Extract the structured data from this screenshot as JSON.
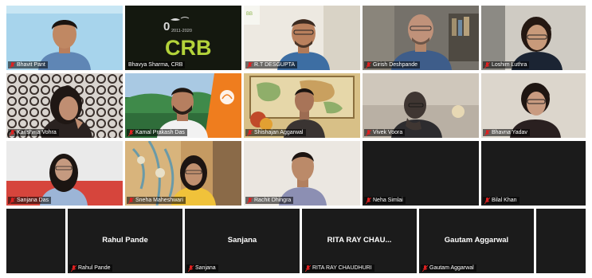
{
  "meeting": {
    "background": "#1b1b1b",
    "mic_muted_color": "#e02020",
    "active_speaker_color": "#f5d400"
  },
  "tiles": [
    {
      "name": "Bhavit Pant"
    },
    {
      "name": "Bhavya Sharma, CRB",
      "logo": {
        "year": "2011-2020",
        "text": "CRB"
      }
    },
    {
      "name": "R.T DESGUPTA"
    },
    {
      "name": "Girish Deshpande"
    },
    {
      "name": "Loshim Luthra"
    },
    {
      "name": "Karishma Vohra"
    },
    {
      "name": "Kamal Prakash Das"
    },
    {
      "name": "Shishajan Aggarwal"
    },
    {
      "name": "Vivek Voora"
    },
    {
      "name": "Bhavna Yadav"
    },
    {
      "name": "Sanjana Das"
    },
    {
      "name": "Sneha Maheshwari"
    },
    {
      "name": "Rachit Dhingra"
    },
    {
      "name": "Neha Simlai"
    },
    {
      "name": "Bilal Khan"
    },
    {
      "name": "Rahul Pande",
      "display": "Rahul Pande"
    },
    {
      "name": "Sanjana",
      "display": "Sanjana"
    },
    {
      "name": "RITA RAY CHAUDHURI",
      "display": "RITA RAY CHAU..."
    },
    {
      "name": "Gautam Aggarwal",
      "display": "Gautam Aggarwal"
    }
  ]
}
